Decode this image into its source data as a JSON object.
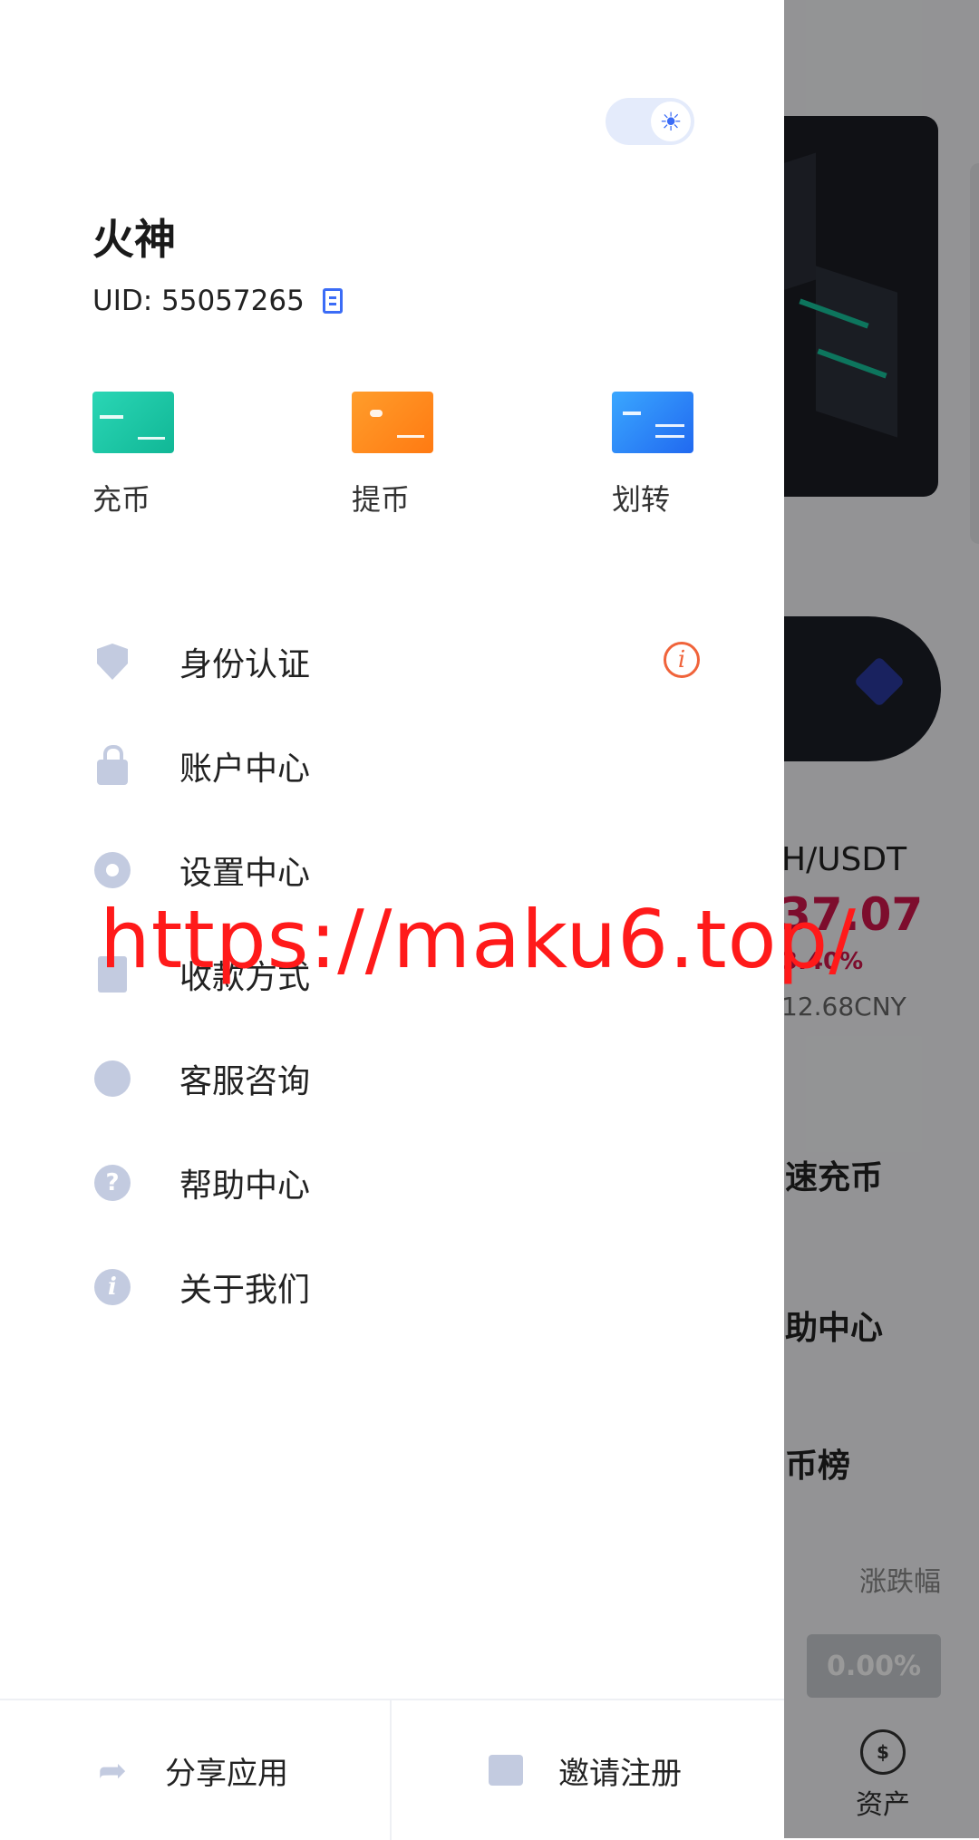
{
  "drawer": {
    "user": {
      "name": "火神",
      "uid": "UID: 55057265"
    },
    "quick_actions": [
      {
        "label": "充币",
        "icon": "deposit-card-icon",
        "color": "#17c3a0"
      },
      {
        "label": "提币",
        "icon": "withdraw-wallet-icon",
        "color": "#ff8a1f"
      },
      {
        "label": "划转",
        "icon": "transfer-card-icon",
        "color": "#2f8cf4"
      }
    ],
    "menu": [
      {
        "label": "身份认证",
        "icon": "shield-check-icon"
      },
      {
        "label": "账户中心",
        "icon": "lock-icon"
      },
      {
        "label": "设置中心",
        "icon": "gear-icon"
      },
      {
        "label": "收款方式",
        "icon": "document-icon"
      },
      {
        "label": "客服咨询",
        "icon": "headset-icon"
      },
      {
        "label": "帮助中心",
        "icon": "question-icon"
      },
      {
        "label": "关于我们",
        "icon": "info-icon"
      }
    ],
    "bottom": {
      "share_label": "分享应用",
      "invite_label": "邀请注册"
    }
  },
  "background": {
    "pair": "H/USDT",
    "price": "37.07",
    "change": "3.40%",
    "cny": "12.68CNY",
    "quick_recharge": "速充币",
    "help_center": "助中心",
    "ranking": "币榜",
    "change_header": "涨跌幅",
    "change_value": "0.00%",
    "asset_label": "资产",
    "asset_icon_glyph": "$"
  },
  "watermark": "https://maku6.top/",
  "colors": {
    "accent": "#3b6cf6",
    "warning": "#f0633a",
    "icon_gray": "#c3cbe0",
    "price_red": "#d0174b"
  }
}
